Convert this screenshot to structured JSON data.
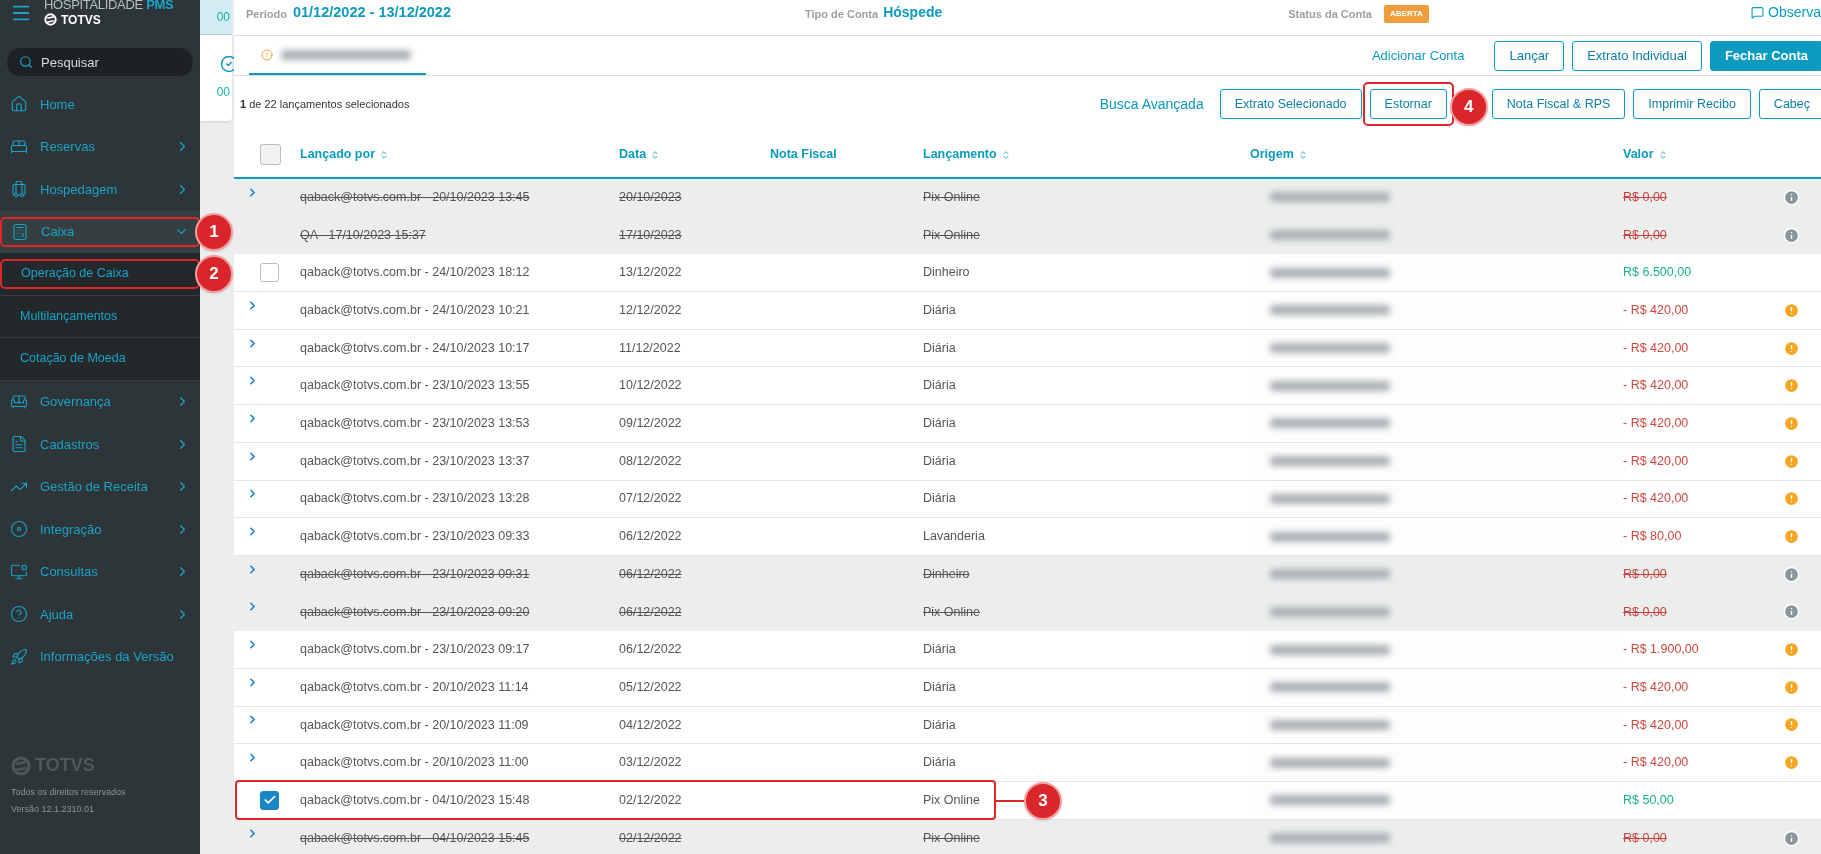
{
  "sidebar": {
    "brand": "HOSPITALIDADE",
    "product": "PMS",
    "company": "TOTVS",
    "search": {
      "placeholder": "Pesquisar"
    },
    "items": [
      {
        "label": "Home",
        "has_children": false
      },
      {
        "label": "Reservas",
        "has_children": true,
        "expanded": false
      },
      {
        "label": "Hospedagem",
        "has_children": true,
        "expanded": false
      },
      {
        "label": "Caixa",
        "has_children": true,
        "expanded": true,
        "callout": "1",
        "children": [
          {
            "label": "Operação de Caixa",
            "callout": "2"
          },
          {
            "label": "Multilançamentos"
          },
          {
            "label": "Cotação de Moeda"
          }
        ]
      },
      {
        "label": "Governança",
        "has_children": true,
        "expanded": false
      },
      {
        "label": "Cadastros",
        "has_children": true,
        "expanded": false
      },
      {
        "label": "Gestão de Receita",
        "has_children": true,
        "expanded": false
      },
      {
        "label": "Integração",
        "has_children": true,
        "expanded": false
      },
      {
        "label": "Consultas",
        "has_children": true,
        "expanded": false
      },
      {
        "label": "Ajuda",
        "has_children": true,
        "expanded": false
      },
      {
        "label": "Informações da Versão",
        "has_children": false
      }
    ],
    "footer": {
      "logo": "TOTVS",
      "rights": "Todos os direitos reservados",
      "version": "Versão 12.1.2310.01"
    }
  },
  "side_cards": [
    "00",
    "00"
  ],
  "header": {
    "period_label": "Período",
    "period": "01/12/2022 - 13/12/2022",
    "type_label": "Tipo de Conta",
    "type": "Hóspede",
    "status_label": "Status da Conta",
    "status": "ABERTA",
    "notes": "Observa"
  },
  "tabs": [
    {
      "selected": true
    }
  ],
  "account_actions": {
    "link": "Adicionar Conta",
    "buttons": [
      {
        "label": "Lançar",
        "primary": false
      },
      {
        "label": "Extrato Individual",
        "primary": false
      },
      {
        "label": "Fechar Conta",
        "primary": true
      }
    ]
  },
  "selection": {
    "count": "1",
    "text": "de 22 lançamentos selecionados"
  },
  "entry_actions": {
    "link": "Busca Avançada",
    "buttons": [
      {
        "label": "Extrato Selecionado"
      },
      {
        "label": "Estornar",
        "callout": "4"
      },
      {
        "label": "Nota Fiscal & RPS"
      },
      {
        "label": "Imprimir Recibo"
      },
      {
        "label": "Cabeç"
      }
    ]
  },
  "table": {
    "select_all_checked": false,
    "columns": [
      {
        "label": "Lançado por",
        "sortable": true
      },
      {
        "label": "Data",
        "sortable": true
      },
      {
        "label": "Nota Fiscal",
        "sortable": false
      },
      {
        "label": "Lançamento",
        "sortable": true
      },
      {
        "label": "Origem",
        "sortable": true
      },
      {
        "label": "Valor",
        "sortable": true
      }
    ],
    "rows": [
      {
        "kind": "expandable",
        "by": "qaback@totvs.com.br - 20/10/2023 13:45",
        "date": "20/10/2023",
        "entry": "Pix Online",
        "value": "R$ 0,00",
        "color": "#c9423f",
        "cancelled": true,
        "pending": false
      },
      {
        "kind": "plain",
        "by": "QA - 17/10/2023 15:37",
        "date": "17/10/2023",
        "entry": "Pix Online",
        "value": "R$ 0,00",
        "color": "#c9423f",
        "cancelled": true,
        "pending": false
      },
      {
        "kind": "selectable",
        "checked": false,
        "by": "qaback@totvs.com.br - 24/10/2023 18:12",
        "date": "13/12/2022",
        "entry": "Dinheiro",
        "value": "R$ 6.500,00",
        "color": "#14b48c",
        "cancelled": false,
        "pending": false
      },
      {
        "kind": "expandable",
        "by": "qaback@totvs.com.br - 24/10/2023 10:21",
        "date": "12/12/2022",
        "entry": "Diária",
        "value": "- R$ 420,00",
        "color": "#d0463c",
        "cancelled": false,
        "pending": true
      },
      {
        "kind": "expandable",
        "by": "qaback@totvs.com.br - 24/10/2023 10:17",
        "date": "11/12/2022",
        "entry": "Diária",
        "value": "- R$ 420,00",
        "color": "#d0463c",
        "cancelled": false,
        "pending": true
      },
      {
        "kind": "expandable",
        "by": "qaback@totvs.com.br - 23/10/2023 13:55",
        "date": "10/12/2022",
        "entry": "Diária",
        "value": "- R$ 420,00",
        "color": "#d0463c",
        "cancelled": false,
        "pending": true
      },
      {
        "kind": "expandable",
        "by": "qaback@totvs.com.br - 23/10/2023 13:53",
        "date": "09/12/2022",
        "entry": "Diária",
        "value": "- R$ 420,00",
        "color": "#d0463c",
        "cancelled": false,
        "pending": true
      },
      {
        "kind": "expandable",
        "by": "qaback@totvs.com.br - 23/10/2023 13:37",
        "date": "08/12/2022",
        "entry": "Diária",
        "value": "- R$ 420,00",
        "color": "#d0463c",
        "cancelled": false,
        "pending": true
      },
      {
        "kind": "expandable",
        "by": "qaback@totvs.com.br - 23/10/2023 13:28",
        "date": "07/12/2022",
        "entry": "Diária",
        "value": "- R$ 420,00",
        "color": "#d0463c",
        "cancelled": false,
        "pending": true
      },
      {
        "kind": "expandable",
        "by": "qaback@totvs.com.br - 23/10/2023 09:33",
        "date": "06/12/2022",
        "entry": "Lavanderia",
        "value": "- R$ 80,00",
        "color": "#d0463c",
        "cancelled": false,
        "pending": true
      },
      {
        "kind": "expandable",
        "by": "qaback@totvs.com.br - 23/10/2023 09:31",
        "date": "06/12/2022",
        "entry": "Dinheiro",
        "value": "R$ 0,00",
        "color": "#c9423f",
        "cancelled": true,
        "pending": false
      },
      {
        "kind": "expandable",
        "by": "qaback@totvs.com.br - 23/10/2023 09:20",
        "date": "06/12/2022",
        "entry": "Pix Online",
        "value": "R$ 0,00",
        "color": "#c9423f",
        "cancelled": true,
        "pending": false
      },
      {
        "kind": "expandable",
        "by": "qaback@totvs.com.br - 23/10/2023 09:17",
        "date": "06/12/2022",
        "entry": "Diária",
        "value": "- R$ 1.900,00",
        "color": "#d0463c",
        "cancelled": false,
        "pending": true
      },
      {
        "kind": "expandable",
        "by": "qaback@totvs.com.br - 20/10/2023 11:14",
        "date": "05/12/2022",
        "entry": "Diária",
        "value": "- R$ 420,00",
        "color": "#d0463c",
        "cancelled": false,
        "pending": true
      },
      {
        "kind": "expandable",
        "by": "qaback@totvs.com.br - 20/10/2023 11:09",
        "date": "04/12/2022",
        "entry": "Diária",
        "value": "- R$ 420,00",
        "color": "#d0463c",
        "cancelled": false,
        "pending": true
      },
      {
        "kind": "expandable",
        "by": "qaback@totvs.com.br - 20/10/2023 11:00",
        "date": "03/12/2022",
        "entry": "Diária",
        "value": "- R$ 420,00",
        "color": "#d0463c",
        "cancelled": false,
        "pending": true
      },
      {
        "kind": "selectable",
        "checked": true,
        "callout": "3",
        "by": "qaback@totvs.com.br - 04/10/2023 15:48",
        "date": "02/12/2022",
        "entry": "Pix Online",
        "value": "R$ 50,00",
        "color": "#14b48c",
        "cancelled": false,
        "pending": false
      },
      {
        "kind": "expandable",
        "by": "qaback@totvs.com.br - 04/10/2023 15:45",
        "date": "02/12/2022",
        "entry": "Pix Online",
        "value": "R$ 0,00",
        "color": "#c9423f",
        "cancelled": true,
        "pending": false
      }
    ]
  }
}
